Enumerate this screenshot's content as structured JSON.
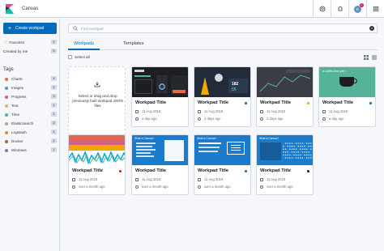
{
  "app": {
    "title": "Canvas",
    "notif_count": "2",
    "user_initial": "E"
  },
  "colors": {
    "accent": "#006bb8",
    "danger": "#bd271e",
    "warning": "#f5a700",
    "primary": "#006bb8",
    "dark": "#1a1c21"
  },
  "sidebar": {
    "create_label": "Create workpad",
    "items": [
      {
        "label": "Favorites",
        "count": "2",
        "icon": "star-icon"
      },
      {
        "label": "Created by me",
        "count": "5",
        "icon": ""
      }
    ],
    "tags_heading": "Tags",
    "tags": [
      {
        "label": "Charts",
        "count": "4",
        "color": "#e7664c"
      },
      {
        "label": "Images",
        "count": "2",
        "color": "#6092c0"
      },
      {
        "label": "Progress",
        "count": "3",
        "color": "#d36086"
      },
      {
        "label": "Text",
        "count": "1",
        "color": "#d6bf57"
      },
      {
        "label": "Time",
        "count": "1",
        "color": "#54b399"
      },
      {
        "label": "Elasticsearch",
        "count": "2",
        "color": "#b9a888"
      },
      {
        "label": "Logstash",
        "count": "1",
        "color": "#da8b45"
      },
      {
        "label": "Docker",
        "count": "1",
        "color": "#aa6556"
      },
      {
        "label": "Windows",
        "count": "1",
        "color": "#9170b8"
      }
    ]
  },
  "main": {
    "search_placeholder": "Find workpad",
    "tabs": [
      {
        "label": "Workpads"
      },
      {
        "label": "Templates"
      }
    ],
    "select_all": "Select all",
    "drop_text": "Select or drag and drop previously built workpad JSON files",
    "cards": [
      {
        "title": "Workpad Title",
        "date": "11 Aug 2019",
        "updated": "a day ago",
        "dot": "",
        "thumb_title": "Twitter Data"
      },
      {
        "title": "Workpad Title",
        "date": "11 Aug 2019",
        "updated": "2 days ago",
        "dot": "#006bb8",
        "thumb_title": ""
      },
      {
        "title": "Workpad Title",
        "date": "11 Aug 2019",
        "updated": "2 days ago",
        "dot": "#f5a700",
        "thumb_title": ""
      },
      {
        "title": "Workpad Title",
        "date": "11 Aug 2019",
        "updated": "a day ago",
        "dot": "#006bb8",
        "thumb_title": "Is coffee time yet?"
      },
      {
        "title": "Workpad Title",
        "date": "11 Aug 2019",
        "updated": "over a month ago",
        "dot": "#bd271e",
        "thumb_title": ""
      },
      {
        "title": "Workpad Title",
        "date": "11 Aug 2019",
        "updated": "over a month ago",
        "dot": "",
        "thumb_title": "What is Canvas?"
      },
      {
        "title": "Workpad Title",
        "date": "11 Aug 2019",
        "updated": "over a month ago",
        "dot": "#006bb8",
        "thumb_title": "What is Canvas?"
      },
      {
        "title": "Workpad Title",
        "date": "11 Aug 2019",
        "updated": "over a month ago",
        "dot": "#1a1c21",
        "thumb_title": "What is Canvas?"
      }
    ],
    "thumb_text": {
      "plane_1": "Live fares in flight",
      "stat_1": "182",
      "stat_2": "55"
    }
  }
}
